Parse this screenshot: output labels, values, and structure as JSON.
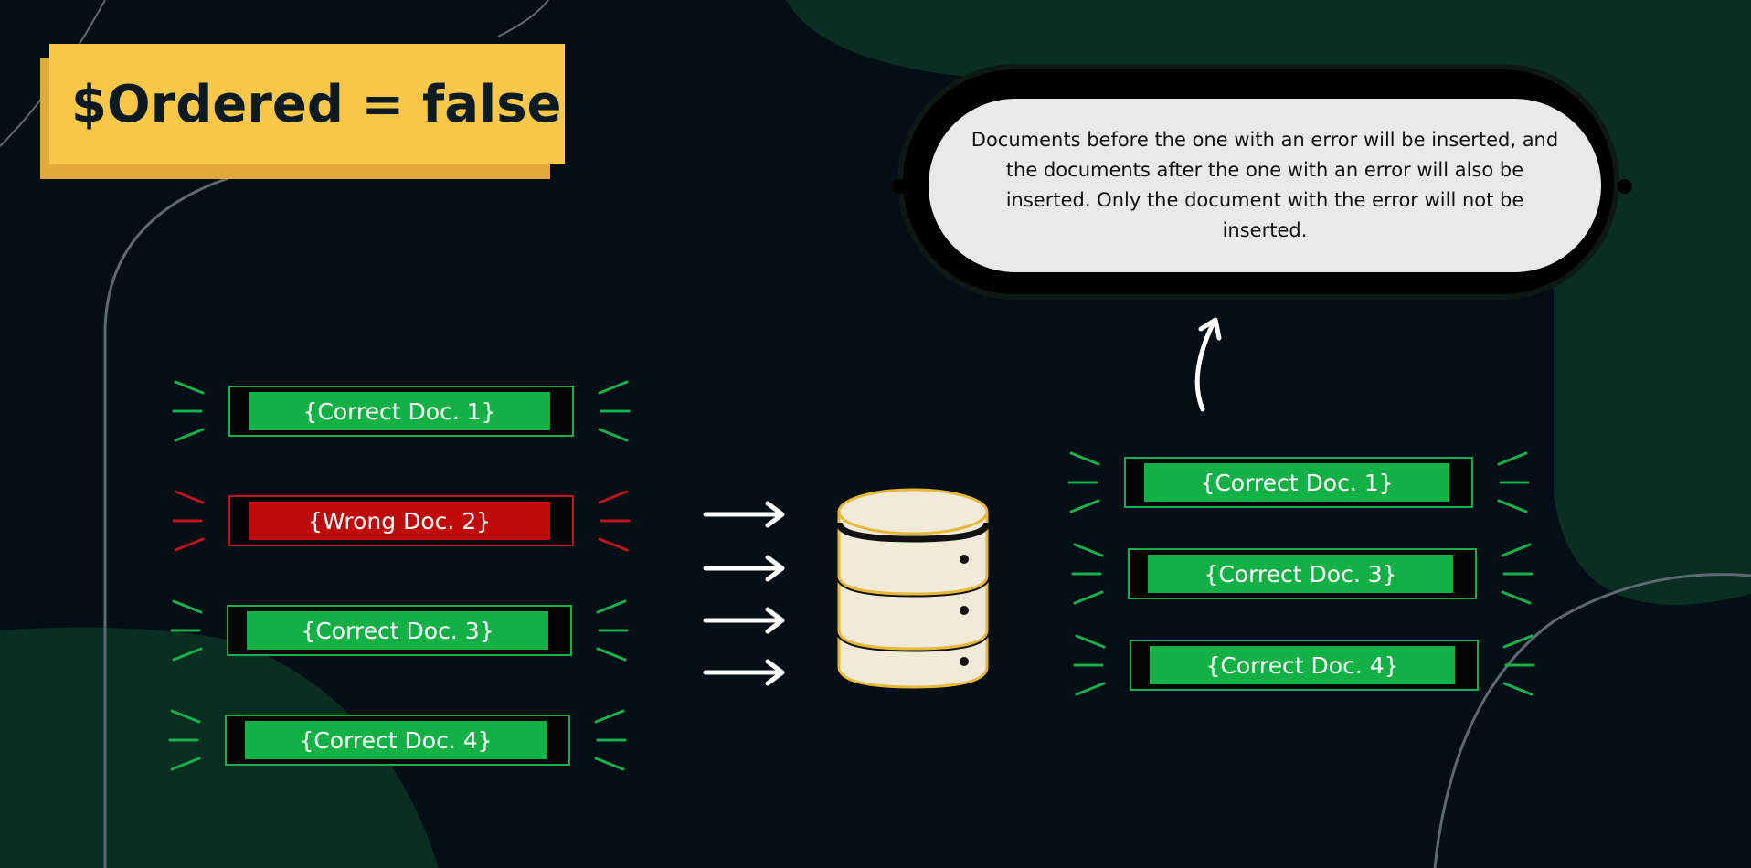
{
  "title": "$Ordered = false",
  "callout": {
    "text": "Documents before the one with an error will be inserted, and the documents after the one with an error will also be inserted. Only the document with the error will not be inserted."
  },
  "input_documents": [
    {
      "label": "{Correct Doc. 1}",
      "status": "correct"
    },
    {
      "label": "{Wrong Doc. 2}",
      "status": "wrong"
    },
    {
      "label": "{Correct Doc. 3}",
      "status": "correct"
    },
    {
      "label": "{Correct Doc. 4}",
      "status": "correct"
    }
  ],
  "inserted_documents": [
    {
      "label": "{Correct Doc. 1}",
      "status": "correct"
    },
    {
      "label": "{Correct Doc. 3}",
      "status": "correct"
    },
    {
      "label": "{Correct Doc. 4}",
      "status": "correct"
    }
  ],
  "icons": {
    "database": "database-icon",
    "arrows": "right-arrow-icon",
    "curved_arrow": "curved-up-arrow-icon"
  },
  "colors": {
    "background": "#030e16",
    "accent_dark_green": "#0a2e22",
    "title_yellow": "#f9c74a",
    "correct_green": "#13b145",
    "wrong_red": "#c00b0b",
    "callout_grey": "#e9e9e9",
    "database_fill": "#f2ead8",
    "database_outline": "#e8b83a"
  }
}
